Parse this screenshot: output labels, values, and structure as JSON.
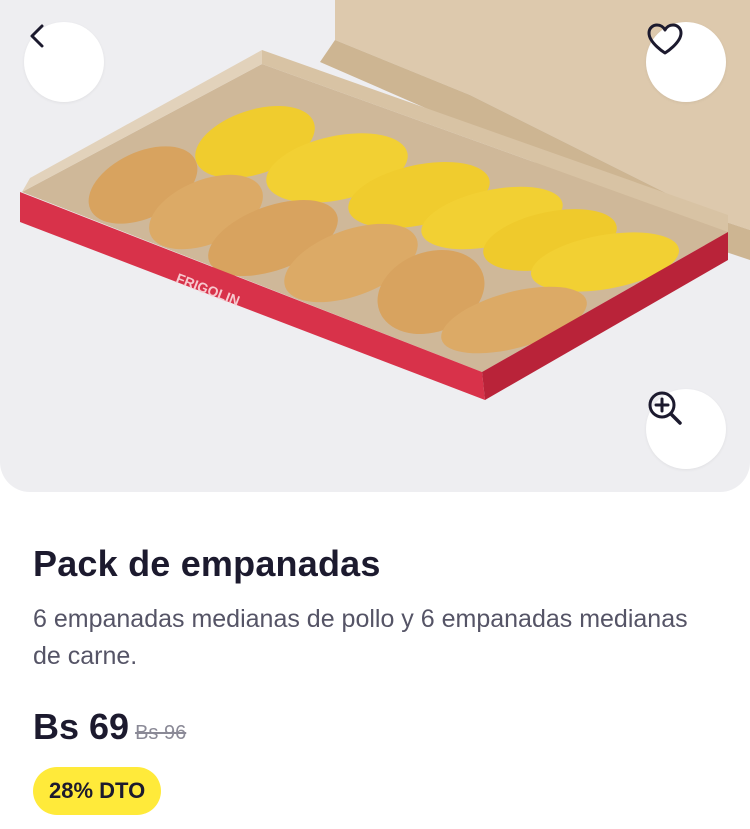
{
  "product": {
    "name": "Pack de empanadas",
    "description": "6 empanadas medianas de pollo y 6 empanadas medianas de carne.",
    "price": "Bs 69",
    "original_price": "Bs 96",
    "discount_badge": "28% DTO"
  },
  "image": {
    "box_brand": "FRIGOLIN"
  },
  "icons": {
    "back": "chevron-left-icon",
    "favorite": "heart-icon",
    "zoom": "zoom-in-icon"
  },
  "colors": {
    "accent_badge": "#ffea3a",
    "text_primary": "#1c1a2e",
    "text_secondary": "#555466",
    "box_red": "#d8324a"
  }
}
